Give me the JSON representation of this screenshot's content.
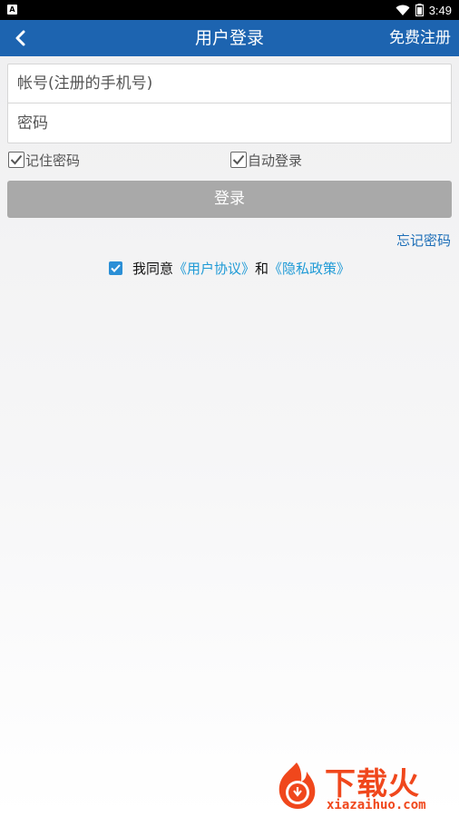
{
  "status_bar": {
    "time": "3:49",
    "icons": [
      "notification-a-icon",
      "wifi-icon",
      "battery-icon"
    ]
  },
  "header": {
    "title": "用户登录",
    "right_action": "免费注册",
    "back_icon": "chevron-left-icon",
    "background_color": "#1d64b0"
  },
  "form": {
    "account_placeholder": "帐号(注册的手机号)",
    "account_value": "",
    "password_placeholder": "密码",
    "password_value": ""
  },
  "options": {
    "remember_label": "记住密码",
    "remember_checked": true,
    "auto_login_label": "自动登录",
    "auto_login_checked": true
  },
  "login_button": {
    "label": "登录",
    "color": "#a9a9a9"
  },
  "forgot_password": "忘记密码",
  "agreement": {
    "checked": true,
    "prefix": "我同意",
    "user_agreement": "《用户协议》",
    "and": "和",
    "privacy_policy": "《隐私政策》"
  },
  "watermark": {
    "brand": "下载火",
    "url": "xiazaihuo.com",
    "color": "#f0471c"
  }
}
